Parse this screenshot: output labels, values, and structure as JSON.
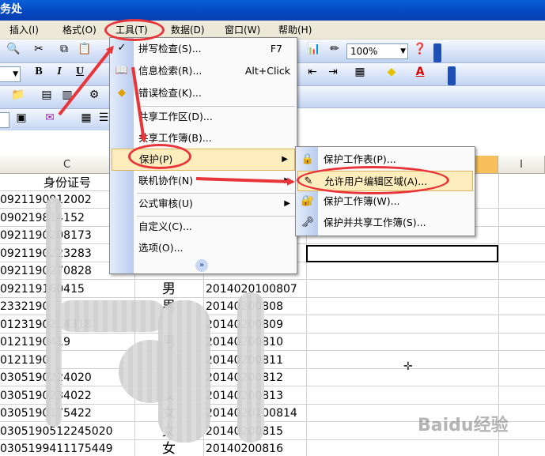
{
  "title_fragment": "务处",
  "menubar": {
    "insert": "插入(I)",
    "format": "格式(O)",
    "tools": "工具(T)",
    "data": "数据(D)",
    "window": "窗口(W)",
    "help": "帮助(H)"
  },
  "toolbar": {
    "zoom": "100%",
    "font_color_letter": "A",
    "bold": "B",
    "italic": "I",
    "underline": "U"
  },
  "columns": {
    "c": "C",
    "i": "I"
  },
  "header_cell": "身份证号",
  "tools_menu": {
    "spelling": "拼写检查(S)...",
    "spelling_shortcut": "F7",
    "research": "信息检索(R)...",
    "research_shortcut": "Alt+Click",
    "error_check": "错误检查(K)...",
    "shared_workspace": "共享工作区(D)...",
    "share_workbook": "共享工作簿(B)...",
    "protection": "保护(P)",
    "online_collab": "联机协作(N)",
    "formula_audit": "公式审核(U)",
    "customize": "自定义(C)...",
    "options": "选项(O)..."
  },
  "protection_menu": {
    "protect_sheet": "保护工作表(P)...",
    "allow_edit_ranges": "允许用户编辑区域(A)...",
    "protect_workbook": "保护工作簿(W)...",
    "protect_share": "保护并共享工作簿(S)..."
  },
  "rows": [
    {
      "id": "0921190912002",
      "sex": "",
      "num": ""
    },
    {
      "id": "090219814152",
      "sex": "",
      "num": ""
    },
    {
      "id": "0921190208173",
      "sex": "",
      "num": ""
    },
    {
      "id": "0921190223283",
      "sex": "",
      "num": ""
    },
    {
      "id": "0921190270828",
      "sex": "",
      "num": ""
    },
    {
      "id": "092119160415",
      "sex": "男",
      "num": "2014020100807"
    },
    {
      "id": "2332190",
      "sex": "男",
      "num": "20140200808"
    },
    {
      "id": "0123190224318",
      "sex": "",
      "num": "20140200809"
    },
    {
      "id": "0121190419",
      "sex": "男",
      "num": "20140200810"
    },
    {
      "id": "0121190",
      "sex": "",
      "num": "20140200811"
    },
    {
      "id": "0305190224020",
      "sex": "女",
      "num": "20140200812"
    },
    {
      "id": "0305190234022",
      "sex": "女",
      "num": "20140200813"
    },
    {
      "id": "0305190175422",
      "sex": "女",
      "num": "2014020100814"
    },
    {
      "id": "0305190512245020",
      "sex": "女",
      "num": "20140200815"
    },
    {
      "id": "0305199411175449",
      "sex": "女",
      "num": "20140200816"
    }
  ],
  "watermark": "Baidu经验",
  "colors": {
    "highlight": "#ffeebd",
    "annotation_red": "#e8353a",
    "title_blue": "#0447c0"
  }
}
